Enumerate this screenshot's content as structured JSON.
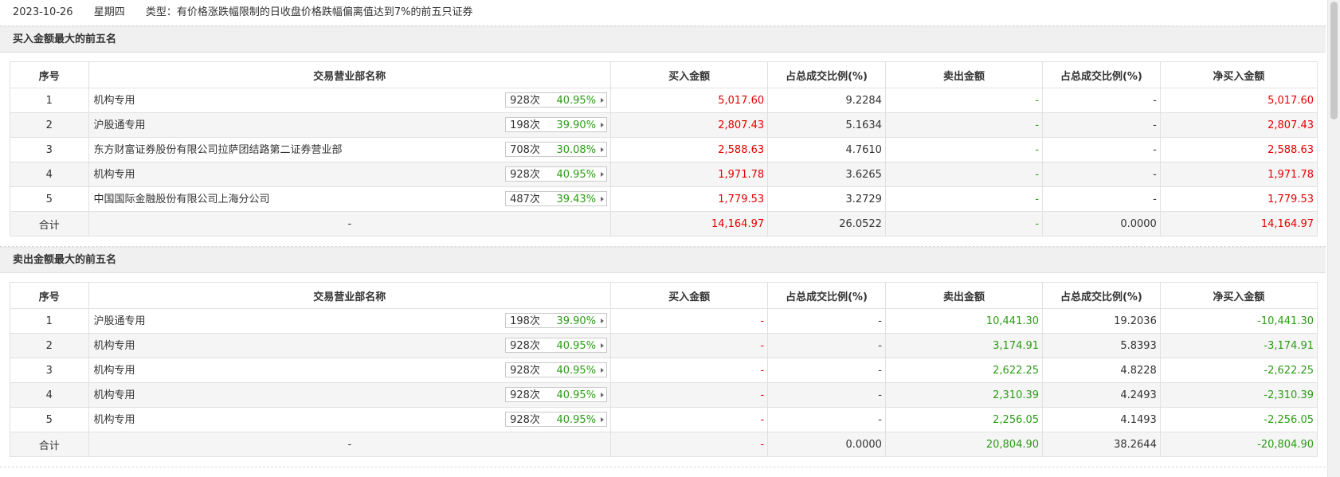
{
  "info": {
    "date": "2023-10-26",
    "weekday": "星期四",
    "type": "类型：有价格涨跌幅限制的日收盘价格跌幅偏离值达到7%的前五只证券"
  },
  "headers": [
    "序号",
    "交易营业部名称",
    "买入金额",
    "占总成交比例(%)",
    "卖出金额",
    "占总成交比例(%)",
    "净买入金额"
  ],
  "colors": {
    "up": "#e60000",
    "down": "#2a9d14",
    "header_bg": "#f0f0f0",
    "stripe": "#f5f5f5"
  },
  "buy": {
    "title": "买入金额最大的前五名",
    "rows": [
      {
        "no": "1",
        "name": "机构专用",
        "count": "928次",
        "pct": "40.95%",
        "buy": "5,017.60",
        "buy_ratio": "9.2284",
        "sell": "-",
        "sell_ratio": "-",
        "net": "5,017.60"
      },
      {
        "no": "2",
        "name": "沪股通专用",
        "count": "198次",
        "pct": "39.90%",
        "buy": "2,807.43",
        "buy_ratio": "5.1634",
        "sell": "-",
        "sell_ratio": "-",
        "net": "2,807.43"
      },
      {
        "no": "3",
        "name": "东方财富证券股份有限公司拉萨团结路第二证券营业部",
        "count": "708次",
        "pct": "30.08%",
        "buy": "2,588.63",
        "buy_ratio": "4.7610",
        "sell": "-",
        "sell_ratio": "-",
        "net": "2,588.63"
      },
      {
        "no": "4",
        "name": "机构专用",
        "count": "928次",
        "pct": "40.95%",
        "buy": "1,971.78",
        "buy_ratio": "3.6265",
        "sell": "-",
        "sell_ratio": "-",
        "net": "1,971.78"
      },
      {
        "no": "5",
        "name": "中国国际金融股份有限公司上海分公司",
        "count": "487次",
        "pct": "39.43%",
        "buy": "1,779.53",
        "buy_ratio": "3.2729",
        "sell": "-",
        "sell_ratio": "-",
        "net": "1,779.53"
      }
    ],
    "total": {
      "label": "合计",
      "name": "-",
      "buy": "14,164.97",
      "buy_ratio": "26.0522",
      "sell": "-",
      "sell_ratio": "0.0000",
      "net": "14,164.97"
    }
  },
  "sell": {
    "title": "卖出金额最大的前五名",
    "rows": [
      {
        "no": "1",
        "name": "沪股通专用",
        "count": "198次",
        "pct": "39.90%",
        "buy": "-",
        "buy_ratio": "-",
        "sell": "10,441.30",
        "sell_ratio": "19.2036",
        "net": "-10,441.30"
      },
      {
        "no": "2",
        "name": "机构专用",
        "count": "928次",
        "pct": "40.95%",
        "buy": "-",
        "buy_ratio": "-",
        "sell": "3,174.91",
        "sell_ratio": "5.8393",
        "net": "-3,174.91"
      },
      {
        "no": "3",
        "name": "机构专用",
        "count": "928次",
        "pct": "40.95%",
        "buy": "-",
        "buy_ratio": "-",
        "sell": "2,622.25",
        "sell_ratio": "4.8228",
        "net": "-2,622.25"
      },
      {
        "no": "4",
        "name": "机构专用",
        "count": "928次",
        "pct": "40.95%",
        "buy": "-",
        "buy_ratio": "-",
        "sell": "2,310.39",
        "sell_ratio": "4.2493",
        "net": "-2,310.39"
      },
      {
        "no": "5",
        "name": "机构专用",
        "count": "928次",
        "pct": "40.95%",
        "buy": "-",
        "buy_ratio": "-",
        "sell": "2,256.05",
        "sell_ratio": "4.1493",
        "net": "-2,256.05"
      }
    ],
    "total": {
      "label": "合计",
      "name": "-",
      "buy": "-",
      "buy_ratio": "0.0000",
      "sell": "20,804.90",
      "sell_ratio": "38.2644",
      "net": "-20,804.90"
    }
  }
}
